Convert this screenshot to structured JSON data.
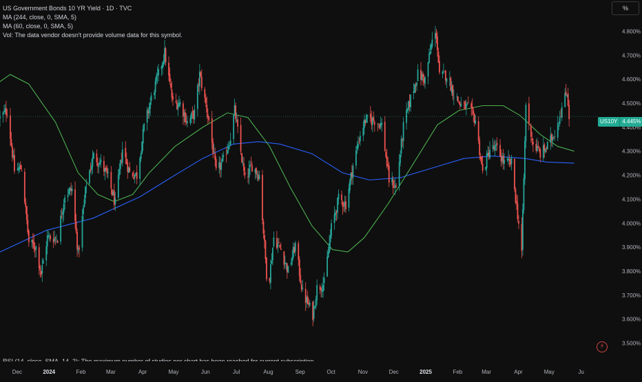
{
  "legend": {
    "title": "US Government Bonds 10 YR Yield · 1D · TVC",
    "ma1": "MA (244, close, 0, SMA, 5)",
    "ma2": "MA (60, close, 0, SMA, 5)",
    "vol": "Vol: The data vendor doesn't provide volume data for this symbol."
  },
  "rsi_note": "RSI (14, close, SMA, 14, 2): The maximum number of studies per chart has been reached for current subscription",
  "unit_label": "%",
  "last_price": {
    "symbol": "US10Y",
    "value": "4.445%"
  },
  "colors": {
    "up": "#26a69a",
    "down": "#ef5350",
    "ma_long": "#2962ff",
    "ma_short": "#4caf50",
    "background": "#0f0f0f",
    "grid": "#1c1c1c",
    "price_line": "#22ab94"
  },
  "icons": {
    "alert": "lightning-icon"
  },
  "chart_data": {
    "type": "candlestick",
    "ylim": [
      3.45,
      4.85
    ],
    "y_ticks": [
      "3.500%",
      "3.600%",
      "3.700%",
      "3.800%",
      "3.900%",
      "4.000%",
      "4.100%",
      "4.200%",
      "4.300%",
      "4.400%",
      "4.500%",
      "4.600%",
      "4.700%",
      "4.800%"
    ],
    "x_ticks": [
      "Dec",
      "2024",
      "Feb",
      "Mar",
      "Apr",
      "May",
      "Jun",
      "Jul",
      "Aug",
      "Sep",
      "Oct",
      "Nov",
      "Dec",
      "2025",
      "Feb",
      "Mar",
      "Apr",
      "May",
      "Ju"
    ],
    "x_start": "2023-11-17",
    "x_end": "2025-06-20",
    "close_path": [
      [
        "2023-11-17",
        4.44
      ],
      [
        "2023-11-24",
        4.47
      ],
      [
        "2023-12-01",
        4.22
      ],
      [
        "2023-12-08",
        4.23
      ],
      [
        "2023-12-15",
        3.92
      ],
      [
        "2023-12-22",
        3.9
      ],
      [
        "2023-12-27",
        3.79
      ],
      [
        "2024-01-02",
        3.94
      ],
      [
        "2024-01-12",
        3.94
      ],
      [
        "2024-01-19",
        4.12
      ],
      [
        "2024-01-26",
        4.14
      ],
      [
        "2024-02-01",
        3.87
      ],
      [
        "2024-02-09",
        4.17
      ],
      [
        "2024-02-16",
        4.28
      ],
      [
        "2024-02-23",
        4.25
      ],
      [
        "2024-03-01",
        4.19
      ],
      [
        "2024-03-08",
        4.08
      ],
      [
        "2024-03-15",
        4.31
      ],
      [
        "2024-03-22",
        4.21
      ],
      [
        "2024-03-29",
        4.2
      ],
      [
        "2024-04-05",
        4.4
      ],
      [
        "2024-04-12",
        4.52
      ],
      [
        "2024-04-19",
        4.62
      ],
      [
        "2024-04-25",
        4.71
      ],
      [
        "2024-05-03",
        4.5
      ],
      [
        "2024-05-10",
        4.5
      ],
      [
        "2024-05-17",
        4.42
      ],
      [
        "2024-05-24",
        4.46
      ],
      [
        "2024-05-29",
        4.62
      ],
      [
        "2024-06-07",
        4.43
      ],
      [
        "2024-06-14",
        4.21
      ],
      [
        "2024-06-21",
        4.26
      ],
      [
        "2024-06-28",
        4.36
      ],
      [
        "2024-07-02",
        4.47
      ],
      [
        "2024-07-12",
        4.18
      ],
      [
        "2024-07-19",
        4.24
      ],
      [
        "2024-07-26",
        4.2
      ],
      [
        "2024-08-02",
        3.79
      ],
      [
        "2024-08-05",
        3.78
      ],
      [
        "2024-08-09",
        3.94
      ],
      [
        "2024-08-16",
        3.89
      ],
      [
        "2024-08-23",
        3.8
      ],
      [
        "2024-08-30",
        3.91
      ],
      [
        "2024-09-06",
        3.71
      ],
      [
        "2024-09-16",
        3.62
      ],
      [
        "2024-09-20",
        3.73
      ],
      [
        "2024-09-27",
        3.75
      ],
      [
        "2024-10-04",
        3.98
      ],
      [
        "2024-10-11",
        4.1
      ],
      [
        "2024-10-18",
        4.08
      ],
      [
        "2024-10-25",
        4.24
      ],
      [
        "2024-11-01",
        4.37
      ],
      [
        "2024-11-06",
        4.43
      ],
      [
        "2024-11-15",
        4.43
      ],
      [
        "2024-11-22",
        4.41
      ],
      [
        "2024-11-29",
        4.18
      ],
      [
        "2024-12-06",
        4.15
      ],
      [
        "2024-12-13",
        4.4
      ],
      [
        "2024-12-20",
        4.52
      ],
      [
        "2024-12-27",
        4.62
      ],
      [
        "2025-01-03",
        4.6
      ],
      [
        "2025-01-10",
        4.76
      ],
      [
        "2025-01-14",
        4.79
      ],
      [
        "2025-01-17",
        4.61
      ],
      [
        "2025-01-24",
        4.62
      ],
      [
        "2025-01-31",
        4.54
      ],
      [
        "2025-02-07",
        4.49
      ],
      [
        "2025-02-14",
        4.48
      ],
      [
        "2025-02-21",
        4.43
      ],
      [
        "2025-02-28",
        4.21
      ],
      [
        "2025-03-07",
        4.31
      ],
      [
        "2025-03-14",
        4.31
      ],
      [
        "2025-03-21",
        4.25
      ],
      [
        "2025-03-28",
        4.25
      ],
      [
        "2025-04-04",
        4.0
      ],
      [
        "2025-04-07",
        3.88
      ],
      [
        "2025-04-11",
        4.49
      ],
      [
        "2025-04-18",
        4.33
      ],
      [
        "2025-04-25",
        4.29
      ],
      [
        "2025-05-02",
        4.32
      ],
      [
        "2025-05-09",
        4.38
      ],
      [
        "2025-05-16",
        4.48
      ],
      [
        "2025-05-21",
        4.55
      ],
      [
        "2025-05-23",
        4.45
      ]
    ],
    "ma_long": [
      [
        "2023-11-17",
        3.88
      ],
      [
        "2024-01-01",
        3.97
      ],
      [
        "2024-02-15",
        4.02
      ],
      [
        "2024-04-01",
        4.11
      ],
      [
        "2024-05-01",
        4.19
      ],
      [
        "2024-06-01",
        4.27
      ],
      [
        "2024-07-01",
        4.33
      ],
      [
        "2024-07-25",
        4.34
      ],
      [
        "2024-08-15",
        4.33
      ],
      [
        "2024-09-15",
        4.29
      ],
      [
        "2024-10-15",
        4.21
      ],
      [
        "2024-11-10",
        4.18
      ],
      [
        "2024-12-10",
        4.19
      ],
      [
        "2025-01-10",
        4.23
      ],
      [
        "2025-02-10",
        4.27
      ],
      [
        "2025-03-10",
        4.28
      ],
      [
        "2025-04-10",
        4.27
      ],
      [
        "2025-05-01",
        4.255
      ],
      [
        "2025-05-28",
        4.25
      ]
    ],
    "ma_short": [
      [
        "2023-11-17",
        4.59
      ],
      [
        "2023-11-27",
        4.62
      ],
      [
        "2023-12-15",
        4.58
      ],
      [
        "2024-01-10",
        4.42
      ],
      [
        "2024-02-01",
        4.21
      ],
      [
        "2024-02-20",
        4.12
      ],
      [
        "2024-03-07",
        4.09
      ],
      [
        "2024-03-25",
        4.12
      ],
      [
        "2024-04-10",
        4.21
      ],
      [
        "2024-05-05",
        4.32
      ],
      [
        "2024-06-01",
        4.4
      ],
      [
        "2024-06-25",
        4.46
      ],
      [
        "2024-07-15",
        4.44
      ],
      [
        "2024-08-05",
        4.32
      ],
      [
        "2024-08-25",
        4.15
      ],
      [
        "2024-09-15",
        3.99
      ],
      [
        "2024-10-05",
        3.89
      ],
      [
        "2024-10-20",
        3.88
      ],
      [
        "2024-11-05",
        3.94
      ],
      [
        "2024-11-28",
        4.08
      ],
      [
        "2024-12-20",
        4.23
      ],
      [
        "2025-01-15",
        4.41
      ],
      [
        "2025-02-05",
        4.47
      ],
      [
        "2025-02-28",
        4.49
      ],
      [
        "2025-03-20",
        4.49
      ],
      [
        "2025-04-05",
        4.45
      ],
      [
        "2025-04-25",
        4.37
      ],
      [
        "2025-05-12",
        4.32
      ],
      [
        "2025-05-28",
        4.3
      ]
    ],
    "last_value": 4.445,
    "grid": false
  }
}
